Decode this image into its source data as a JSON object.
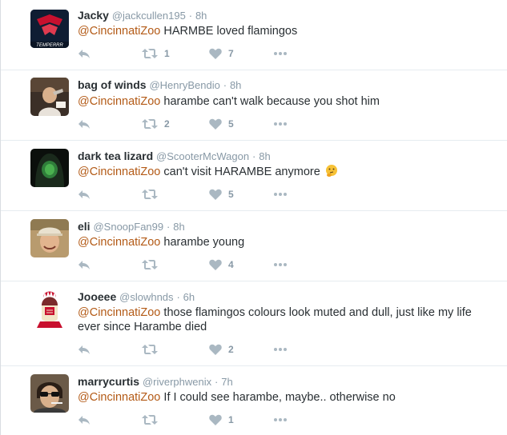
{
  "colors": {
    "mention": "#b35a16",
    "meta": "#8899a6",
    "text": "#292f33",
    "divider": "#e6ecf0"
  },
  "icons": {
    "reply": "reply-arrow-icon",
    "retweet": "retweet-icon",
    "like": "heart-icon",
    "more": "more-options-icon"
  },
  "tweets": [
    {
      "name": "Jacky",
      "username": "@jackcullen195",
      "separator": "·",
      "time": "8h",
      "mention": "@CincinnatiZoo",
      "text": " HARMBE loved flamingos",
      "retweets": "1",
      "likes": "7",
      "avatar_caption": "TEMPERRR"
    },
    {
      "name": "bag of winds",
      "username": "@HenryBendio",
      "separator": "·",
      "time": "8h",
      "mention": "@CincinnatiZoo",
      "text": " harambe can't walk because you shot him",
      "retweets": "2",
      "likes": "5"
    },
    {
      "name": "dark tea lizard",
      "username": "@ScooterMcWagon",
      "separator": "·",
      "time": "8h",
      "mention": "@CincinnatiZoo",
      "text": " can't visit HARAMBE anymore",
      "emoji": "thinking-face-emoji",
      "retweets": "",
      "likes": "5"
    },
    {
      "name": "eli",
      "username": "@SnoopFan99",
      "separator": "·",
      "time": "8h",
      "mention": "@CincinnatiZoo",
      "text": " harambe young",
      "retweets": "",
      "likes": "4"
    },
    {
      "name": "Jooeee",
      "username": "@slowhnds",
      "separator": "·",
      "time": "6h",
      "mention": "@CincinnatiZoo",
      "text": " those flamingos colours look muted and dull, just like my life ever since Harambe died",
      "retweets": "",
      "likes": "2"
    },
    {
      "name": "marrycurtis",
      "username": "@riverphwenix",
      "separator": "·",
      "time": "7h",
      "mention": "@CincinnatiZoo",
      "text": " If I could see harambe, maybe.. otherwise no",
      "retweets": "",
      "likes": "1"
    }
  ]
}
